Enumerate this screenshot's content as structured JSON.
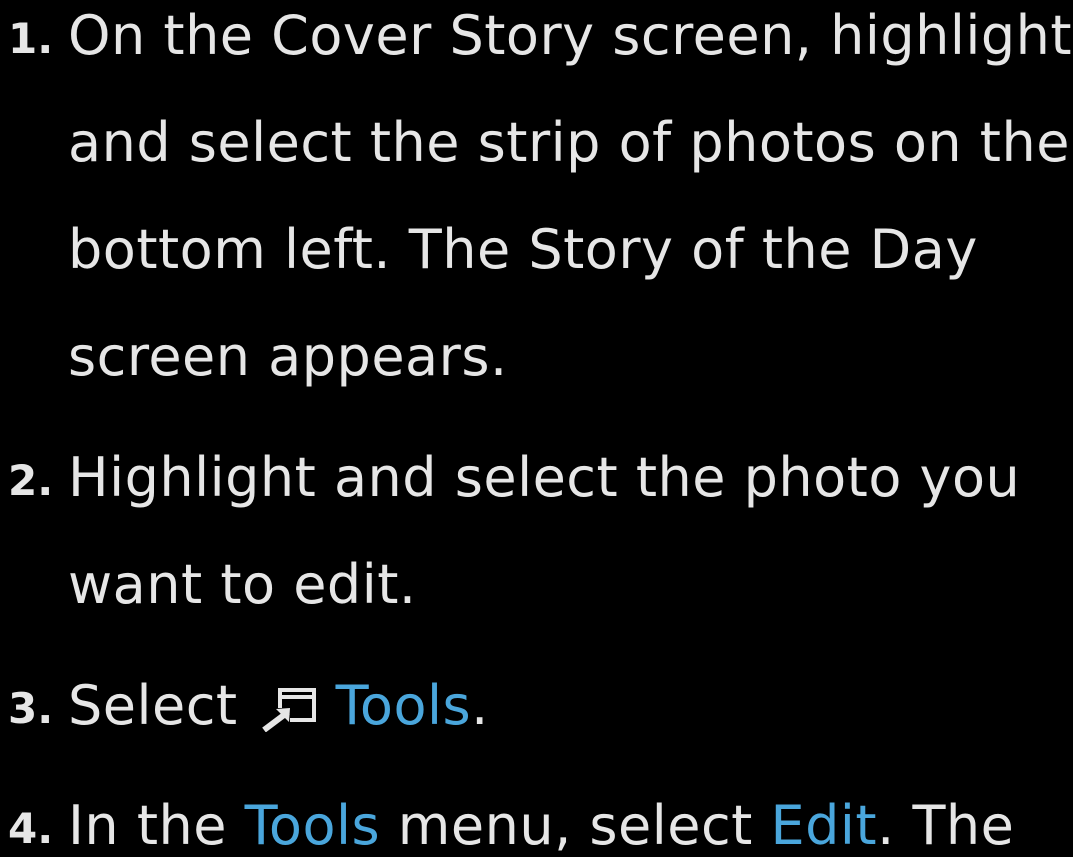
{
  "steps": [
    {
      "number": "1.",
      "lines": [
        "On the Cover Story screen, highlight",
        "and select the strip of photos on the",
        "bottom left. The Story of the Day",
        "screen appears."
      ]
    },
    {
      "number": "2.",
      "lines": [
        "Highlight and select the photo you",
        "want to edit."
      ]
    },
    {
      "number": "3.",
      "prefix": "Select",
      "icon": "tools-icon",
      "link": "Tools",
      "suffix": "."
    },
    {
      "number": "4.",
      "part1": "In the ",
      "link1": "Tools",
      "part2": " menu, select ",
      "link2": "Edit",
      "part3": ". The"
    }
  ],
  "colors": {
    "background": "#000000",
    "text": "#e6e6e6",
    "highlight": "#4aa6dc"
  }
}
